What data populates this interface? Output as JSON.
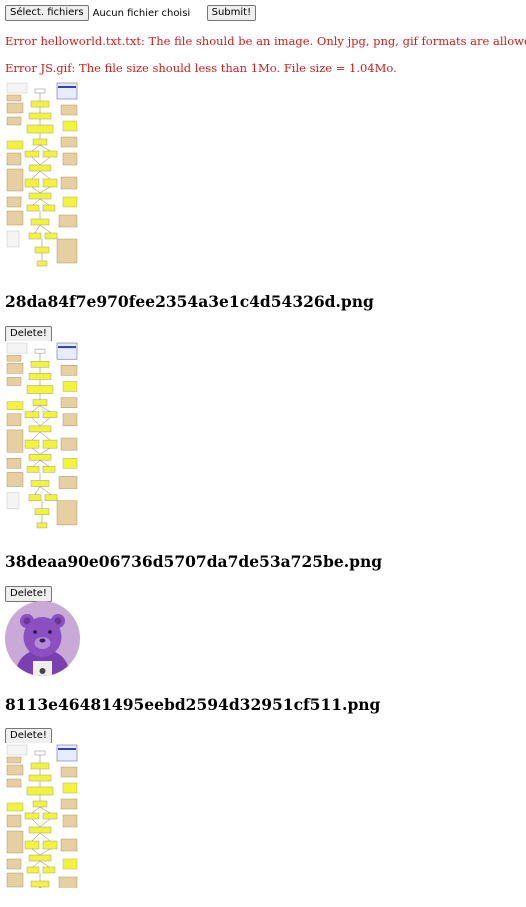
{
  "form": {
    "choose_label": "Sélect. fichiers",
    "file_status": "Aucun fichier choisi",
    "submit_label": "Submit!"
  },
  "errors": [
    "Error helloworld.txt.txt: The file should be an image. Only jpg, png, gif formats are allowed.",
    "Error JS.gif: The file size should less than 1Mo. File size = 1.04Mo."
  ],
  "files": [
    {
      "name": "28da84f7e970fee2354a3e1c4d54326d.png"
    },
    {
      "name": "38deaa90e06736d5707da7de53a725be.png"
    },
    {
      "name": "8113e46481495eebd2594d32951cf511.png"
    }
  ],
  "delete_label": "Delete!",
  "colors": {
    "error": "#d11a1a",
    "flowchart_box": "#f3f33a",
    "flowchart_note": "#e6cfa0",
    "bear_bg": "#c9a9d6",
    "bear": "#8a4fc0"
  }
}
